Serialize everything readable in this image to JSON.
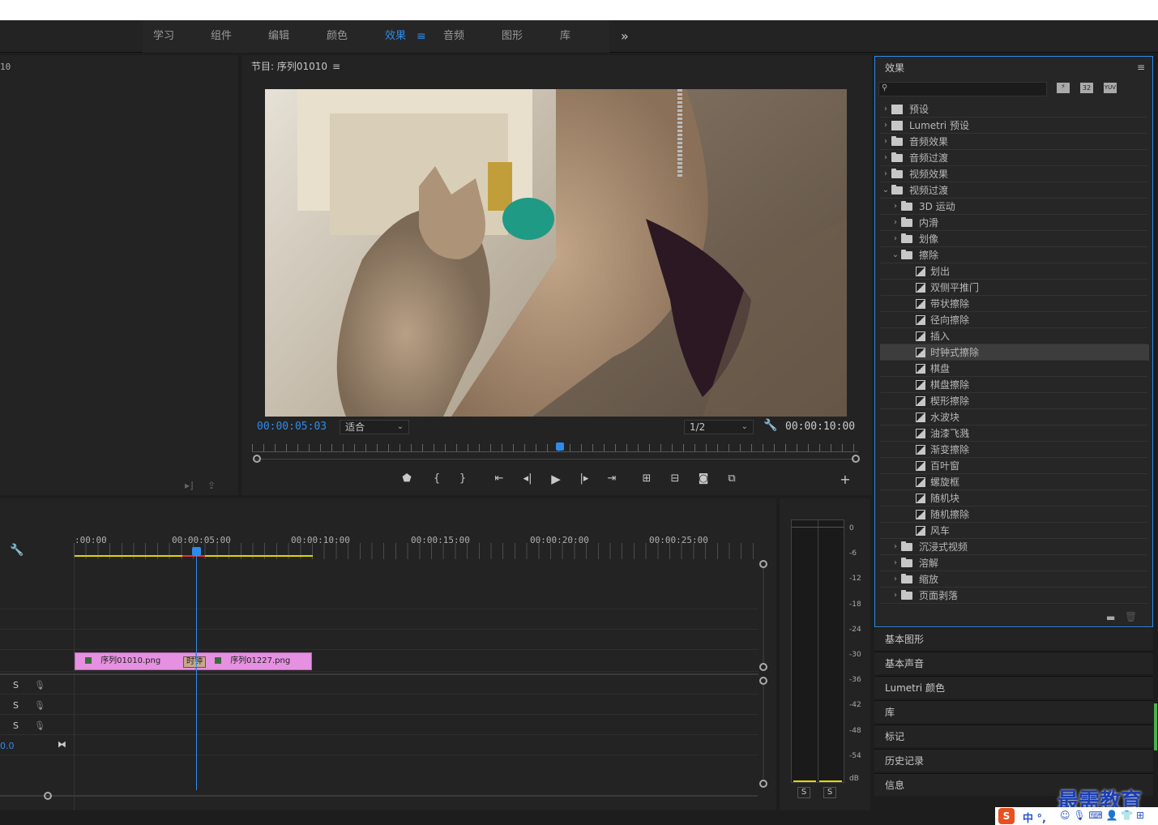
{
  "workspaces": {
    "items": [
      {
        "label": "学习",
        "active": false
      },
      {
        "label": "组件",
        "active": false
      },
      {
        "label": "编辑",
        "active": false
      },
      {
        "label": "颜色",
        "active": false
      },
      {
        "label": "效果",
        "active": true
      },
      {
        "label": "音频",
        "active": false
      },
      {
        "label": "图形",
        "active": false
      },
      {
        "label": "库",
        "active": false
      }
    ],
    "active_menu_icon": "≡",
    "more_icon": "»"
  },
  "source": {
    "partial_timecode": "10"
  },
  "program": {
    "title": "节目: 序列01010",
    "menu_icon": "≡",
    "current_time": "00:00:05:03",
    "zoom_select": "适合",
    "resolution_select": "1/2",
    "duration": "00:00:10:00"
  },
  "timeline": {
    "ruler_labels": [
      ":00:00",
      "00:00:05:00",
      "00:00:10:00",
      "00:00:15:00",
      "00:00:20:00",
      "00:00:25:00"
    ],
    "clips": [
      {
        "name": "序列01010.png"
      },
      {
        "name": "序列01227.png"
      }
    ],
    "transition_label": "时钟",
    "audio_solo": [
      "S",
      "S",
      "S"
    ],
    "master_value": "0.0"
  },
  "meter": {
    "scale": [
      "0",
      "-6",
      "-12",
      "-18",
      "-24",
      "-30",
      "-36",
      "-42",
      "-48",
      "-54",
      "dB"
    ],
    "solo_buttons": [
      "S",
      "S"
    ]
  },
  "effects": {
    "title": "效果",
    "menu_icon": "≡",
    "search_placeholder": "",
    "filter_icons": [
      "accelerated-effects-icon",
      "32bit-icon",
      "yuv-icon"
    ],
    "tree": [
      {
        "label": "预设",
        "level": 0,
        "expanded": false,
        "kind": "bin"
      },
      {
        "label": "Lumetri 预设",
        "level": 0,
        "expanded": false,
        "kind": "bin"
      },
      {
        "label": "音频效果",
        "level": 0,
        "expanded": false,
        "kind": "folder"
      },
      {
        "label": "音频过渡",
        "level": 0,
        "expanded": false,
        "kind": "folder"
      },
      {
        "label": "视频效果",
        "level": 0,
        "expanded": false,
        "kind": "folder"
      },
      {
        "label": "视频过渡",
        "level": 0,
        "expanded": true,
        "kind": "folder"
      },
      {
        "label": "3D 运动",
        "level": 1,
        "expanded": false,
        "kind": "folder"
      },
      {
        "label": "内滑",
        "level": 1,
        "expanded": false,
        "kind": "folder"
      },
      {
        "label": "划像",
        "level": 1,
        "expanded": false,
        "kind": "folder"
      },
      {
        "label": "擦除",
        "level": 1,
        "expanded": true,
        "kind": "folder"
      },
      {
        "label": "划出",
        "level": 2,
        "kind": "transition"
      },
      {
        "label": "双侧平推门",
        "level": 2,
        "kind": "transition"
      },
      {
        "label": "带状擦除",
        "level": 2,
        "kind": "transition"
      },
      {
        "label": "径向擦除",
        "level": 2,
        "kind": "transition"
      },
      {
        "label": "插入",
        "level": 2,
        "kind": "transition"
      },
      {
        "label": "时钟式擦除",
        "level": 2,
        "kind": "transition",
        "selected": true
      },
      {
        "label": "棋盘",
        "level": 2,
        "kind": "transition"
      },
      {
        "label": "棋盘擦除",
        "level": 2,
        "kind": "transition"
      },
      {
        "label": "楔形擦除",
        "level": 2,
        "kind": "transition"
      },
      {
        "label": "水波块",
        "level": 2,
        "kind": "transition"
      },
      {
        "label": "油漆飞溅",
        "level": 2,
        "kind": "transition"
      },
      {
        "label": "渐变擦除",
        "level": 2,
        "kind": "transition"
      },
      {
        "label": "百叶窗",
        "level": 2,
        "kind": "transition"
      },
      {
        "label": "螺旋框",
        "level": 2,
        "kind": "transition"
      },
      {
        "label": "随机块",
        "level": 2,
        "kind": "transition"
      },
      {
        "label": "随机擦除",
        "level": 2,
        "kind": "transition"
      },
      {
        "label": "风车",
        "level": 2,
        "kind": "transition"
      },
      {
        "label": "沉浸式视频",
        "level": 1,
        "expanded": false,
        "kind": "folder"
      },
      {
        "label": "溶解",
        "level": 1,
        "expanded": false,
        "kind": "folder"
      },
      {
        "label": "缩放",
        "level": 1,
        "expanded": false,
        "kind": "folder"
      },
      {
        "label": "页面剥落",
        "level": 1,
        "expanded": false,
        "kind": "folder"
      }
    ]
  },
  "collapsed_panels": [
    "基本图形",
    "基本声音",
    "Lumetri 颜色",
    "库",
    "标记",
    "历史记录",
    "信息"
  ],
  "watermark": {
    "text": "最需教育",
    "ime_text": "中 °,"
  },
  "colors": {
    "accent": "#2d8ceb",
    "clip": "#e590e0",
    "playhead": "#2d8ceb",
    "workarea": "#e5d400"
  }
}
